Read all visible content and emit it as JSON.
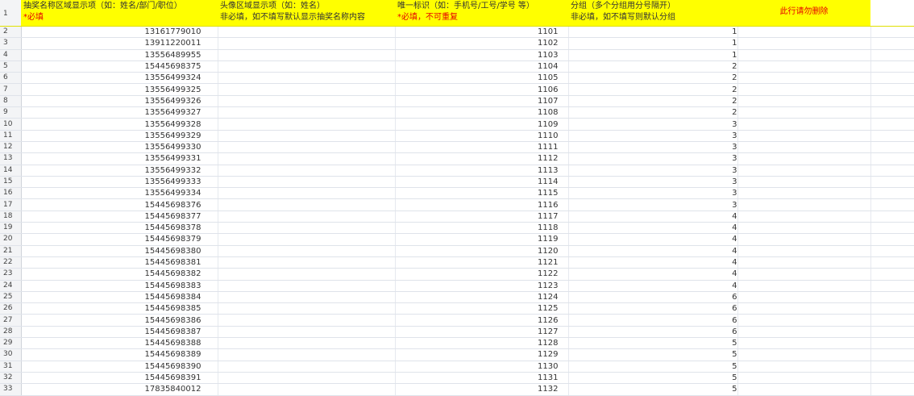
{
  "headers": [
    {
      "line1": "抽奖名称区域显示项（如：姓名/部门/职位）",
      "line2": "*必填"
    },
    {
      "line1": "头像区域显示项（如：姓名）",
      "line2": "非必填，如不填写默认显示抽奖名称内容"
    },
    {
      "line1": "唯一标识（如：手机号/工号/学号 等）",
      "line2": "*必填，不可重复"
    },
    {
      "line1": "分组（多个分组用分号隔开）",
      "line2": "非必填，如不填写则默认分组"
    },
    {
      "line1": "此行请勿删除"
    }
  ],
  "rows": [
    {
      "n": "2",
      "a": "13161779010",
      "c": "1101",
      "d": "1"
    },
    {
      "n": "3",
      "a": "13911220011",
      "c": "1102",
      "d": "1"
    },
    {
      "n": "4",
      "a": "13556489955",
      "c": "1103",
      "d": "1"
    },
    {
      "n": "5",
      "a": "15445698375",
      "c": "1104",
      "d": "2"
    },
    {
      "n": "6",
      "a": "13556499324",
      "c": "1105",
      "d": "2"
    },
    {
      "n": "7",
      "a": "13556499325",
      "c": "1106",
      "d": "2"
    },
    {
      "n": "8",
      "a": "13556499326",
      "c": "1107",
      "d": "2"
    },
    {
      "n": "9",
      "a": "13556499327",
      "c": "1108",
      "d": "2"
    },
    {
      "n": "10",
      "a": "13556499328",
      "c": "1109",
      "d": "3"
    },
    {
      "n": "11",
      "a": "13556499329",
      "c": "1110",
      "d": "3"
    },
    {
      "n": "12",
      "a": "13556499330",
      "c": "1111",
      "d": "3"
    },
    {
      "n": "13",
      "a": "13556499331",
      "c": "1112",
      "d": "3"
    },
    {
      "n": "14",
      "a": "13556499332",
      "c": "1113",
      "d": "3"
    },
    {
      "n": "15",
      "a": "13556499333",
      "c": "1114",
      "d": "3"
    },
    {
      "n": "16",
      "a": "13556499334",
      "c": "1115",
      "d": "3"
    },
    {
      "n": "17",
      "a": "15445698376",
      "c": "1116",
      "d": "3"
    },
    {
      "n": "18",
      "a": "15445698377",
      "c": "1117",
      "d": "4"
    },
    {
      "n": "19",
      "a": "15445698378",
      "c": "1118",
      "d": "4"
    },
    {
      "n": "20",
      "a": "15445698379",
      "c": "1119",
      "d": "4"
    },
    {
      "n": "21",
      "a": "15445698380",
      "c": "1120",
      "d": "4"
    },
    {
      "n": "22",
      "a": "15445698381",
      "c": "1121",
      "d": "4"
    },
    {
      "n": "23",
      "a": "15445698382",
      "c": "1122",
      "d": "4"
    },
    {
      "n": "24",
      "a": "15445698383",
      "c": "1123",
      "d": "4"
    },
    {
      "n": "25",
      "a": "15445698384",
      "c": "1124",
      "d": "6"
    },
    {
      "n": "26",
      "a": "15445698385",
      "c": "1125",
      "d": "6"
    },
    {
      "n": "27",
      "a": "15445698386",
      "c": "1126",
      "d": "6"
    },
    {
      "n": "28",
      "a": "15445698387",
      "c": "1127",
      "d": "6"
    },
    {
      "n": "29",
      "a": "15445698388",
      "c": "1128",
      "d": "5"
    },
    {
      "n": "30",
      "a": "15445698389",
      "c": "1129",
      "d": "5"
    },
    {
      "n": "31",
      "a": "15445698390",
      "c": "1130",
      "d": "5"
    },
    {
      "n": "32",
      "a": "15445698391",
      "c": "1131",
      "d": "5"
    },
    {
      "n": "33",
      "a": "17835840012",
      "c": "1132",
      "d": "5"
    }
  ],
  "header_row_number": "1",
  "colors": {
    "header_bg": "#ffff00",
    "required_text": "#e60000"
  }
}
